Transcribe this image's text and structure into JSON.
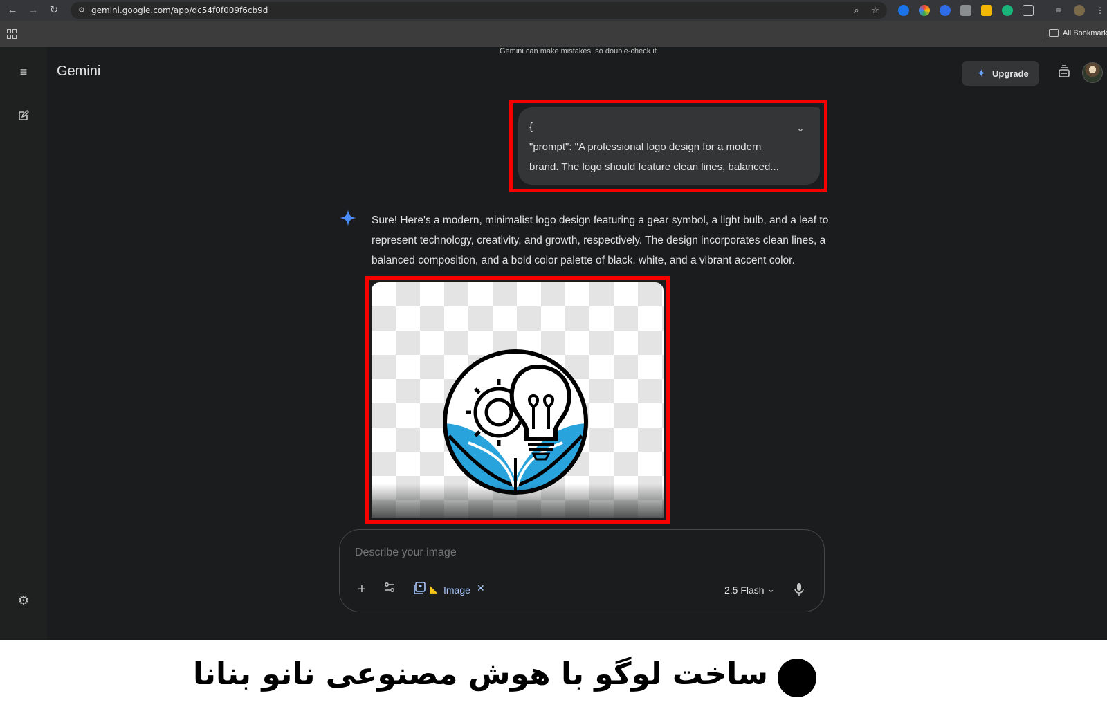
{
  "browser": {
    "url": "gemini.google.com/app/dc54f0f009f6cb9d",
    "bookmarks_label": "All Bookmarks"
  },
  "app": {
    "title": "Gemini",
    "upgrade_label": "Upgrade"
  },
  "conversation": {
    "user_prompt_lines": [
      "{",
      "\"prompt\": \"A professional logo design for a modern",
      "brand. The logo should feature clean lines, balanced..."
    ],
    "response_lines": [
      "Sure! Here's a modern, minimalist logo design featuring a gear symbol, a light bulb, and a leaf to",
      "represent technology, creativity, and growth, respectively. The design incorporates clean lines, a",
      "balanced composition, and a bold color palette of black, white, and a vibrant accent color."
    ]
  },
  "composer": {
    "placeholder": "Describe your image",
    "tool_chip_label": "Image",
    "model_label": "2.5 Flash"
  },
  "disclaimer": "Gemini can make mistakes, so double-check it",
  "caption": "ساخت لوگو با هوش مصنوعی نانو بنانا",
  "colors": {
    "highlight_red": "#f60000",
    "accent_blue": "#29a3dc",
    "background": "#1b1c1d"
  }
}
